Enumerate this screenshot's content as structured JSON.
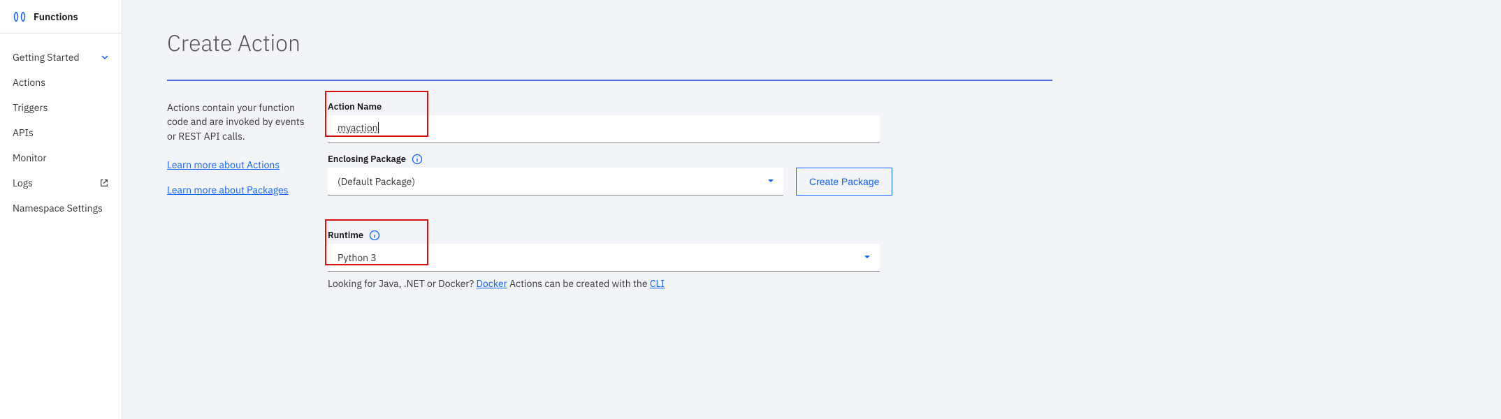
{
  "sidebar": {
    "title": "Functions",
    "items": [
      {
        "label": "Getting Started",
        "expandable": true
      },
      {
        "label": "Actions"
      },
      {
        "label": "Triggers"
      },
      {
        "label": "APIs"
      },
      {
        "label": "Monitor"
      },
      {
        "label": "Logs",
        "external": true
      },
      {
        "label": "Namespace Settings"
      }
    ]
  },
  "page": {
    "title": "Create Action",
    "description": "Actions contain your function code and are invoked by events or REST API calls.",
    "learn_actions": "Learn more about Actions",
    "learn_packages": "Learn more about Packages"
  },
  "form": {
    "action_name_label": "Action Name",
    "action_name_value": "myaction",
    "enclosing_package_label": "Enclosing Package",
    "enclosing_package_value": "(Default Package)",
    "create_package_button": "Create Package",
    "runtime_label": "Runtime",
    "runtime_value": "Python 3",
    "runtime_hint_prefix": "Looking for Java, .NET or Docker? ",
    "runtime_hint_docker": "Docker",
    "runtime_hint_middle": " Actions can be created with the ",
    "runtime_hint_cli": "CLI"
  }
}
